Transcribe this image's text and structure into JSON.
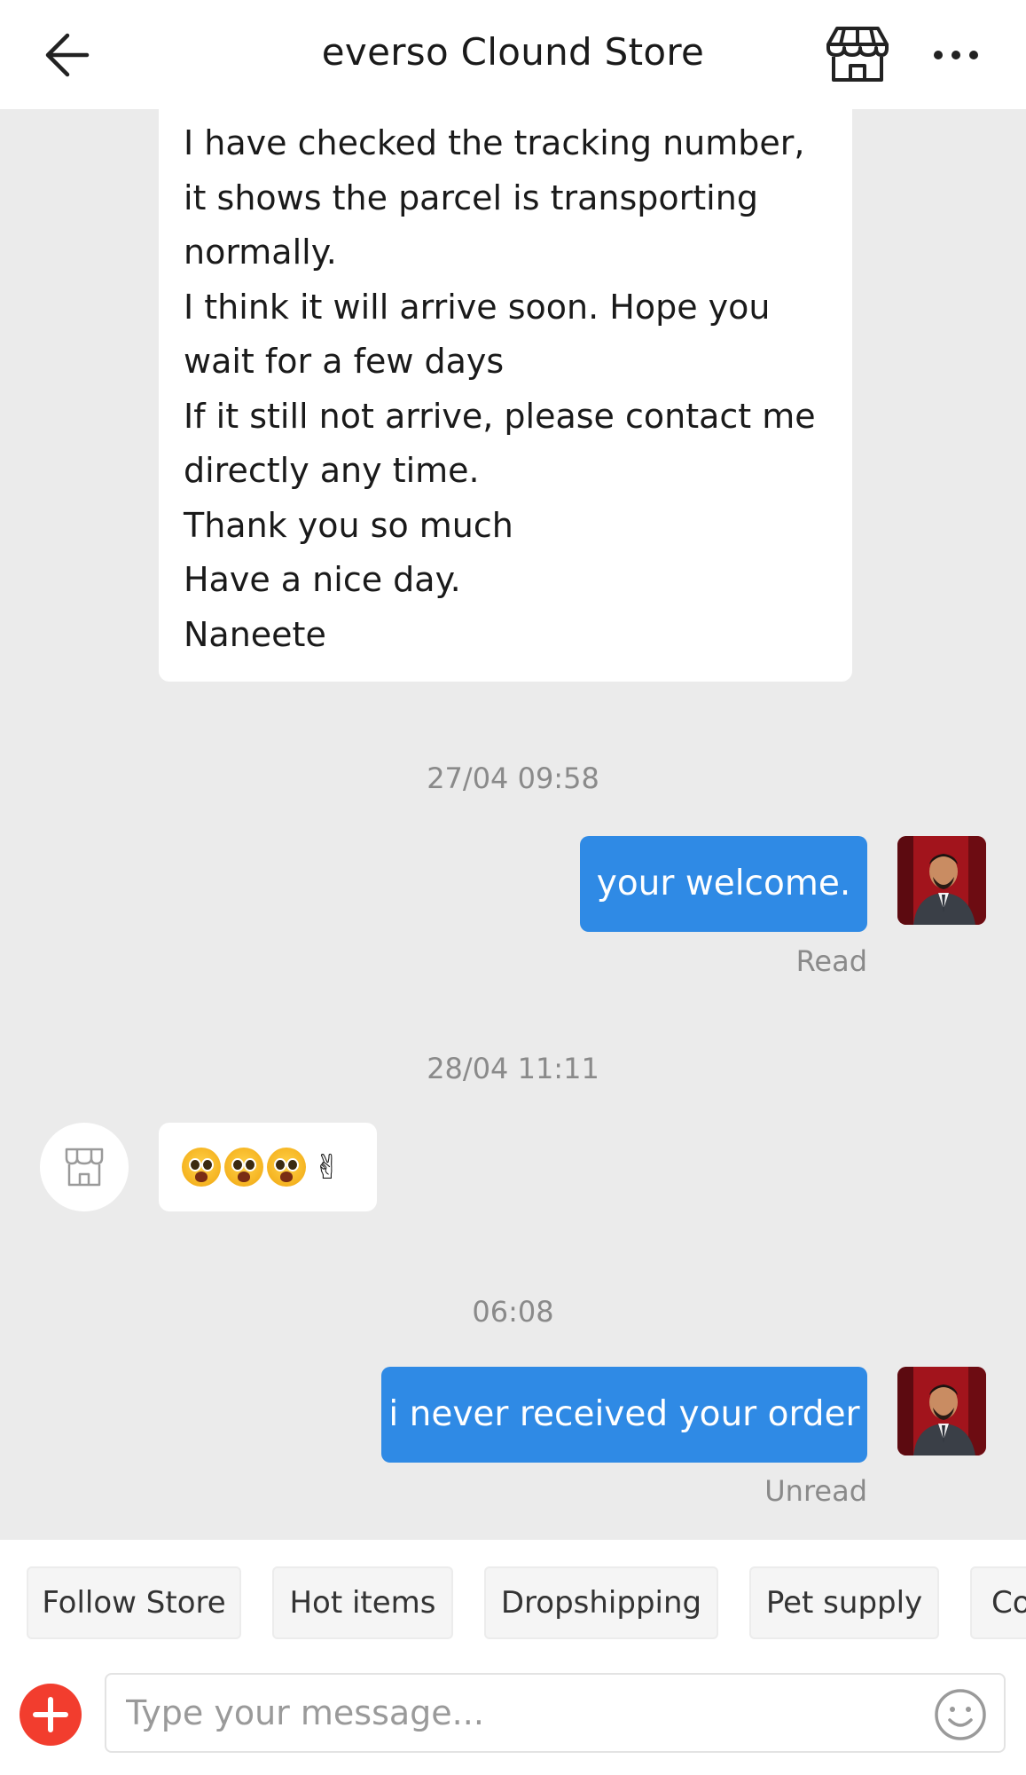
{
  "header": {
    "title": "everso Clound Store",
    "back_icon": "arrow-left-icon",
    "store_icon": "storefront-icon",
    "more_icon": "more-horizontal-icon"
  },
  "messages": {
    "store_long_text": "I have checked the tracking number,  it shows the parcel is transporting normally.\nI think it will arrive soon. Hope you wait for a few days\nIf it still not arrive, please contact me directly any time.\nThank you so much\nHave a nice day.\nNaneete",
    "timestamp_1": "27/04 09:58",
    "user_msg_1": "your welcome.",
    "user_msg_1_status": "Read",
    "timestamp_2": "28/04 11:11",
    "store_emoji_icons": [
      "crying-face-icon",
      "crying-face-icon",
      "crying-face-icon",
      "victory-hand-icon"
    ],
    "timestamp_3": "06:08",
    "user_msg_2": "i never received your order",
    "user_msg_2_status": "Unread"
  },
  "quick_replies": [
    "Follow Store",
    "Hot items",
    "Dropshipping",
    "Pet supply",
    "Co"
  ],
  "composer": {
    "placeholder": "Type your message...",
    "value": "",
    "add_icon": "plus-circle-icon",
    "emoji_icon": "smiley-icon"
  },
  "colors": {
    "accent_blue": "#2f8ae5",
    "add_red": "#f23d2e",
    "background": "#ebebeb"
  }
}
